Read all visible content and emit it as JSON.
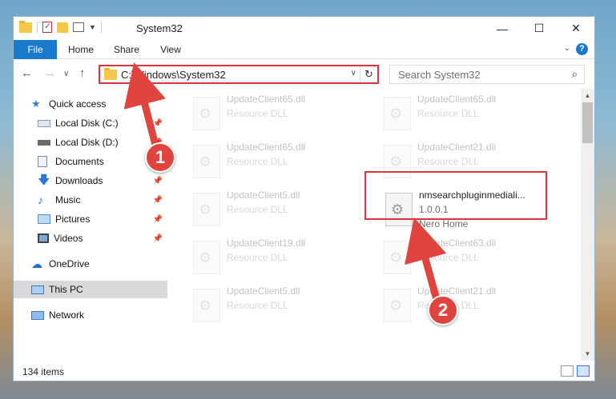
{
  "window": {
    "title": "System32",
    "controls": {
      "minimize": "—",
      "maximize": "☐",
      "close": "✕"
    }
  },
  "ribbon": {
    "tabs": [
      {
        "label": "File"
      },
      {
        "label": "Home"
      },
      {
        "label": "Share"
      },
      {
        "label": "View"
      }
    ],
    "help": "?"
  },
  "nav": {
    "back": "←",
    "forward": "→",
    "recent": "∨",
    "up": "↑",
    "address": "C:\\Windows\\System32",
    "search_placeholder": "Search System32"
  },
  "sidebar": {
    "items": [
      {
        "label": "Quick access",
        "icon": "star-icon",
        "pinned": false,
        "selected": false
      },
      {
        "label": "Local Disk (C:)",
        "icon": "drive-icon",
        "pinned": true,
        "selected": false
      },
      {
        "label": "Local Disk (D:)",
        "icon": "drive-icon",
        "pinned": true,
        "selected": false
      },
      {
        "label": "Documents",
        "icon": "documents-icon",
        "pinned": true,
        "selected": false
      },
      {
        "label": "Downloads",
        "icon": "downloads-icon",
        "pinned": true,
        "selected": false
      },
      {
        "label": "Music",
        "icon": "music-icon",
        "pinned": true,
        "selected": false
      },
      {
        "label": "Pictures",
        "icon": "pictures-icon",
        "pinned": true,
        "selected": false
      },
      {
        "label": "Videos",
        "icon": "videos-icon",
        "pinned": true,
        "selected": false
      },
      {
        "label": "OneDrive",
        "icon": "cloud-icon",
        "pinned": false,
        "selected": false
      },
      {
        "label": "This PC",
        "icon": "computer-icon",
        "pinned": false,
        "selected": true
      },
      {
        "label": "Network",
        "icon": "network-icon",
        "pinned": false,
        "selected": false
      }
    ]
  },
  "files": [
    {
      "name": "UpdateClient65.dll",
      "type": "Resource DLL",
      "extra": "",
      "faded": true
    },
    {
      "name": "UpdateClient65.dll",
      "type": "Resource DLL",
      "extra": "",
      "faded": true
    },
    {
      "name": "UpdateClient65.dll",
      "type": "Resource DLL",
      "extra": "",
      "faded": true
    },
    {
      "name": "UpdateClient21.dll",
      "type": "Resource DLL",
      "extra": "",
      "faded": true
    },
    {
      "name": "UpdateClient5.dll",
      "type": "Resource DLL",
      "extra": "",
      "faded": true
    },
    {
      "name": "nmsearchpluginmediali...",
      "type": "1.0.0.1",
      "extra": "Nero Home",
      "faded": false
    },
    {
      "name": "UpdateClient19.dll",
      "type": "Resource DLL",
      "extra": "",
      "faded": true
    },
    {
      "name": "UpdateClient63.dll",
      "type": "Resource DLL",
      "extra": "",
      "faded": true
    },
    {
      "name": "UpdateClient5.dll",
      "type": "Resource DLL",
      "extra": "",
      "faded": true
    },
    {
      "name": "UpdateClient21.dll",
      "type": "Resource DLL",
      "extra": "",
      "faded": true
    }
  ],
  "status": {
    "item_count": "134 items"
  },
  "annotations": {
    "step1": "1",
    "step2": "2",
    "color": "#e0443e"
  }
}
